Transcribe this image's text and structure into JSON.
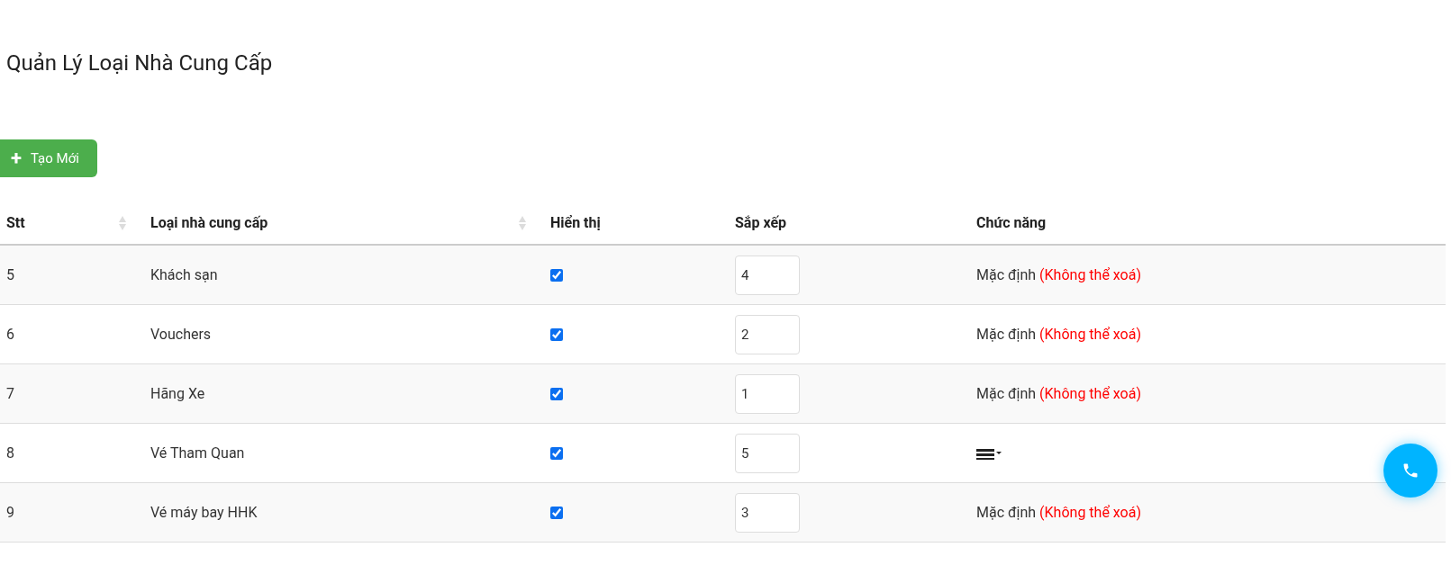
{
  "title": "Quản Lý Loại Nhà Cung Cấp",
  "create_button": {
    "icon": "+",
    "label": "Tạo Mới"
  },
  "table": {
    "columns": [
      {
        "label": "Stt",
        "sortable": true
      },
      {
        "label": "Loại nhà cung cấp",
        "sortable": true
      },
      {
        "label": "Hiển thị",
        "sortable": false
      },
      {
        "label": "Sắp xếp",
        "sortable": false
      },
      {
        "label": "Chức năng",
        "sortable": false
      }
    ],
    "rows": [
      {
        "stt": "5",
        "name": "Khách sạn",
        "visible": true,
        "order": "4",
        "action": {
          "kind": "default",
          "text": "Mặc định",
          "note": "(Không thể xoá)"
        }
      },
      {
        "stt": "6",
        "name": "Vouchers",
        "visible": true,
        "order": "2",
        "action": {
          "kind": "default",
          "text": "Mặc định",
          "note": "(Không thể xoá)"
        }
      },
      {
        "stt": "7",
        "name": "Hãng Xe",
        "visible": true,
        "order": "1",
        "action": {
          "kind": "default",
          "text": "Mặc định",
          "note": "(Không thể xoá)"
        }
      },
      {
        "stt": "8",
        "name": "Vé Tham Quan",
        "visible": true,
        "order": "5",
        "action": {
          "kind": "menu"
        }
      },
      {
        "stt": "9",
        "name": "Vé máy bay HHK",
        "visible": true,
        "order": "3",
        "action": {
          "kind": "default",
          "text": "Mặc định",
          "note": "(Không thể xoá)"
        }
      }
    ]
  }
}
